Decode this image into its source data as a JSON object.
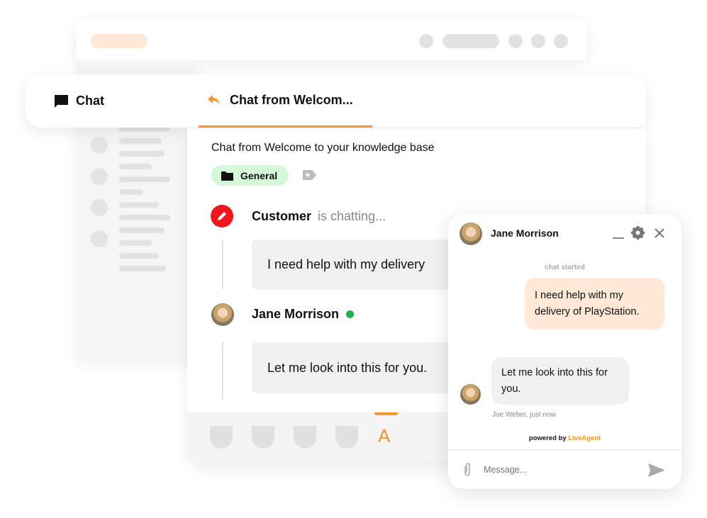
{
  "colors": {
    "accent": "#f7952f",
    "tag_bg": "#d5f8d8",
    "user_bubble": "#fde9d6",
    "agent_bubble": "#f0f0f0",
    "edit_badge": "#f2151b",
    "online": "#22b14c"
  },
  "sidebar_tab": {
    "label": "Chat",
    "icon": "chat-bubble-icon"
  },
  "active_tab": {
    "label": "Chat from Welcom...",
    "icon": "reply-arrow-icon"
  },
  "conversation": {
    "subject": "Chat from Welcome to your knowledge base",
    "tag": {
      "label": "General",
      "icon": "folder-icon"
    },
    "add_tag_icon": "add-tag-icon",
    "messages": [
      {
        "author": "Customer",
        "status": "is chatting...",
        "text": "I need help with my delivery",
        "icon": "pencil-icon"
      },
      {
        "author": "Jane Morrison",
        "text": "Let me look into this for you.",
        "online": true
      }
    ],
    "toolbar_active_label": "A"
  },
  "widget": {
    "agent_name": "Jane Morrison",
    "chat_started": "chat started",
    "user_message": "I need help with my delivery of PlayStation.",
    "agent_message": "Let me look into this for you.",
    "agent_meta": "Joe Weber, just now",
    "powered_by": "powered by",
    "brand": "LiveAgent",
    "message_placeholder": "Message..."
  }
}
